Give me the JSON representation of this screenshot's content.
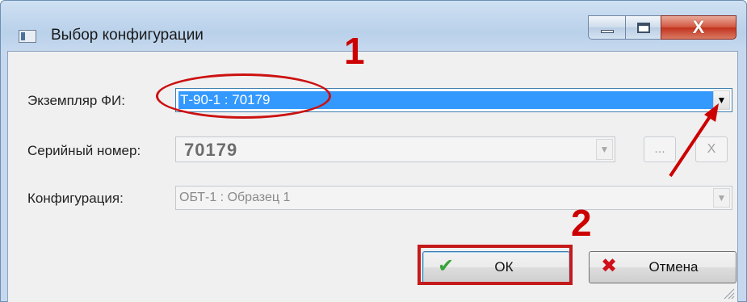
{
  "window": {
    "title": "Выбор конфигурации",
    "close_glyph": "X"
  },
  "form": {
    "instance_label": "Экземпляр ФИ:",
    "instance_value": "Т-90-1   : 70179",
    "serial_label": "Серийный номер:",
    "serial_value": "70179",
    "browse_label": "...",
    "clear_label": "X",
    "config_label": "Конфигурация:",
    "config_value": "ОБТ-1 : Образец 1"
  },
  "buttons": {
    "ok_label": "ОК",
    "cancel_label": "Отмена"
  },
  "annotations": {
    "step1": "1",
    "step2": "2",
    "color": "#cc0000"
  },
  "icons": {
    "app": "window-app-icon",
    "minimize": "minimize-icon",
    "maximize": "maximize-icon",
    "close": "close-icon",
    "ok": "checkmark-icon",
    "cancel": "cross-icon",
    "dropdown": "chevron-down-icon",
    "grip": "resize-grip-icon"
  }
}
